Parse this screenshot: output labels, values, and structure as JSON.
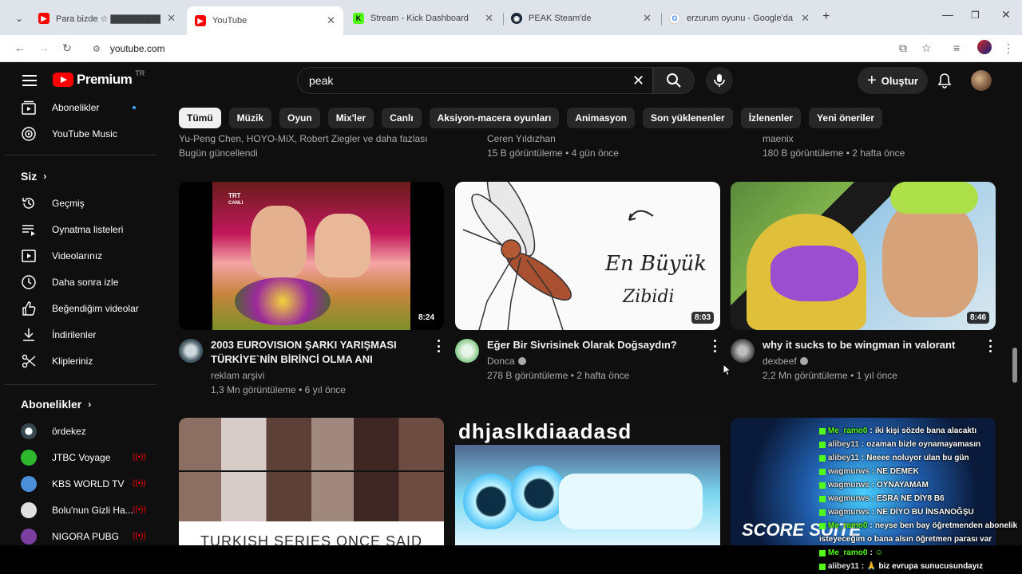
{
  "browser": {
    "tabs": [
      {
        "title": "Para bizde ☆ ▇▇▇▇▇▇▇▇▇",
        "favicon": "youtube-icon",
        "active": false
      },
      {
        "title": "YouTube",
        "favicon": "youtube-icon",
        "active": true
      },
      {
        "title": "Stream - Kick Dashboard",
        "favicon": "kick-icon",
        "active": false
      },
      {
        "title": "PEAK Steam'de",
        "favicon": "steam-icon",
        "active": false
      },
      {
        "title": "erzurum oyunu - Google'da Ara",
        "favicon": "google-icon",
        "active": false
      }
    ],
    "url": "youtube.com"
  },
  "header": {
    "logo_text": "Premium",
    "country_code": "TR",
    "search_value": "peak",
    "create_label": "Oluştur"
  },
  "sidebar": {
    "top_items": [
      {
        "label": "Abonelikler",
        "icon": "subscriptions-icon"
      },
      {
        "label": "YouTube Music",
        "icon": "youtube-music-icon"
      }
    ],
    "you_heading": "Siz",
    "you_items": [
      {
        "label": "Geçmiş",
        "icon": "history-icon"
      },
      {
        "label": "Oynatma listeleri",
        "icon": "playlists-icon"
      },
      {
        "label": "Videolarınız",
        "icon": "your-videos-icon"
      },
      {
        "label": "Daha sonra izle",
        "icon": "watch-later-icon"
      },
      {
        "label": "Beğendiğim videolar",
        "icon": "liked-icon"
      },
      {
        "label": "İndirilenler",
        "icon": "downloads-icon"
      },
      {
        "label": "Klipleriniz",
        "icon": "clips-icon"
      }
    ],
    "subs_heading": "Abonelikler",
    "channels": [
      {
        "label": "ördekez",
        "live": false
      },
      {
        "label": "JTBC Voyage",
        "live": true
      },
      {
        "label": "KBS WORLD TV",
        "live": true
      },
      {
        "label": "Bolu'nun Gizli Ha...",
        "live": true
      },
      {
        "label": "NIGORA PUBG",
        "live": true
      }
    ]
  },
  "chips": [
    "Tümü",
    "Müzik",
    "Oyun",
    "Mix'ler",
    "Canlı",
    "Aksiyon-macera oyunları",
    "Animasyon",
    "Son yüklenenler",
    "İzlenenler",
    "Yeni öneriler"
  ],
  "prev_row": [
    {
      "line1": "Yu-Peng Chen, HOYO-MiX, Robert Ziegler ve daha fazlası",
      "line2": "Bugün güncellendi"
    },
    {
      "line1": "Ceren Yıldızhan",
      "line2": "15 B görüntüleme • 4 gün önce"
    },
    {
      "line1": "maenix",
      "line2": "180 B görüntüleme • 2 hafta önce"
    }
  ],
  "videos": [
    {
      "title_line1": "2003 EUROVISION ŞARKI YARIŞMASI",
      "title_line2": "TÜRKİYE`NİN BİRİNCİ OLMA ANI",
      "channel": "reklam arşivi",
      "meta": "1,3 Mn görüntüleme • 6 yıl önce",
      "duration": "8:24",
      "verified": false
    },
    {
      "title_line1": "Eğer Bir Sivrisinek Olarak Doğsaydın?",
      "title_line2": "",
      "channel": "Donca",
      "meta": "278 B görüntüleme • 2 hafta önce",
      "duration": "8:03",
      "verified": true
    },
    {
      "title_line1": "why it sucks to be wingman in valorant",
      "title_line2": "",
      "channel": "dexbeef",
      "meta": "2,2 Mn görüntüleme • 1 yıl önce",
      "duration": "8:46",
      "verified": true
    }
  ],
  "thumb_texts": {
    "mosquito_line1": "En Büyük",
    "mosquito_line2": "Zibidi",
    "trt_logo": "TRT",
    "trt_sub": "CANLI",
    "bottom1": "TURKISH SERIES ONCE SAID",
    "bottom2": "dhjaslkdiaadasd",
    "bottom3": "SCORE SUITE"
  },
  "chat": [
    {
      "user": "Me_ramo0",
      "msg": "iki kişi sözde bana alacaktı",
      "style": "green"
    },
    {
      "user": "alibey11",
      "msg": "ozaman bizle oynamayamasın",
      "style": "white"
    },
    {
      "user": "alibey11",
      "msg": "Neeee noluyor ulan bu gün",
      "style": "white"
    },
    {
      "user": "wagmurws",
      "msg": "NE DEMEK",
      "style": "white"
    },
    {
      "user": "wagmurws",
      "msg": "OYNAYAMAM",
      "style": "white"
    },
    {
      "user": "wagmurws",
      "msg": "ESRA NE DİY8 B6",
      "style": "white"
    },
    {
      "user": "wagmurws",
      "msg": "NE DİYO BU İNSANOĞŞU",
      "style": "white"
    },
    {
      "user": "Me_ramo0",
      "msg": "neyse ben bay öğretmenden abonelik",
      "style": "green"
    },
    {
      "user": "",
      "msg": "isteyeceğim o bana alsın öğretmen parası var",
      "style": "cont"
    },
    {
      "user": "Me_ramo0",
      "msg": "☺",
      "style": "green"
    },
    {
      "user": "alibey11",
      "msg": "🙏 biz evrupa sunucusundayız",
      "style": "white"
    }
  ],
  "colors": {
    "yt_red": "#ff0000",
    "kick_green": "#53fc18",
    "bg": "#0f0f0f",
    "chip": "#272727"
  }
}
